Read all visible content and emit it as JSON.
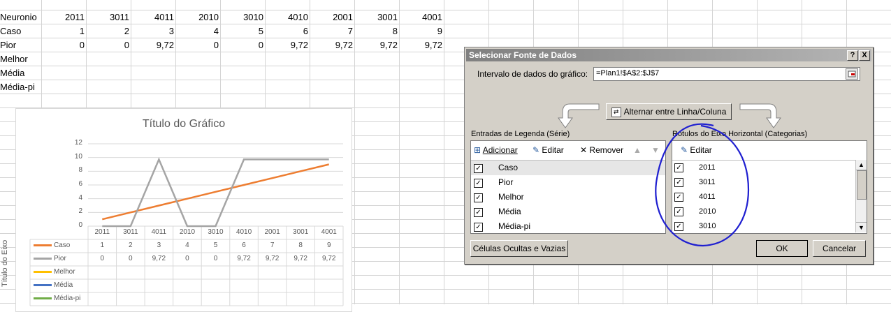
{
  "sheet": {
    "row_labels": [
      "Neuronio",
      "Caso",
      "Pior",
      "Melhor",
      "Média",
      "Média-pi"
    ],
    "headers": [
      "2011",
      "3011",
      "4011",
      "2010",
      "3010",
      "4010",
      "2001",
      "3001",
      "4001"
    ],
    "caso": [
      "1",
      "2",
      "3",
      "4",
      "5",
      "6",
      "7",
      "8",
      "9"
    ],
    "pior": [
      "0",
      "0",
      "9,72",
      "0",
      "0",
      "9,72",
      "9,72",
      "9,72",
      "9,72"
    ]
  },
  "chart": {
    "title": "Título do Gráfico",
    "ylabel": "Título do Eixo",
    "yticks": [
      "12",
      "10",
      "8",
      "6",
      "4",
      "2",
      "0"
    ],
    "legend": [
      "Caso",
      "Pior",
      "Melhor",
      "Média",
      "Média-pi"
    ],
    "colors": {
      "Caso": "#ed7d31",
      "Pior": "#a5a5a5",
      "Melhor": "#ffc000",
      "Média": "#4472c4",
      "Média-pi": "#70ad47"
    }
  },
  "chart_data": {
    "type": "line",
    "title": "Título do Gráfico",
    "xlabel": "",
    "ylabel": "Título do Eixo",
    "ylim": [
      0,
      12
    ],
    "categories": [
      "2011",
      "3011",
      "4011",
      "2010",
      "3010",
      "4010",
      "2001",
      "3001",
      "4001"
    ],
    "series": [
      {
        "name": "Caso",
        "values": [
          1,
          2,
          3,
          4,
          5,
          6,
          7,
          8,
          9
        ]
      },
      {
        "name": "Pior",
        "values": [
          0,
          0,
          9.72,
          0,
          0,
          9.72,
          9.72,
          9.72,
          9.72
        ]
      },
      {
        "name": "Melhor",
        "values": []
      },
      {
        "name": "Média",
        "values": []
      },
      {
        "name": "Média-pi",
        "values": []
      }
    ],
    "grid": true,
    "legend": "data-table"
  },
  "dialog": {
    "title": "Selecionar Fonte de Dados",
    "help_btn": "?",
    "close_btn": "X",
    "range_label": "Intervalo de dados do gráfico:",
    "range_value": "=Plan1!$A$2:$J$7",
    "switch_button": "Alternar entre Linha/Coluna",
    "legend_header": "Entradas de Legenda (Série)",
    "axis_header": "Rótulos do Eixo Horizontal (Categorias)",
    "add": "Adicionar",
    "edit": "Editar",
    "remove": "Remover",
    "edit_axis": "Editar",
    "series": [
      "Caso",
      "Pior",
      "Melhor",
      "Média",
      "Média-pi"
    ],
    "categories": [
      "2011",
      "3011",
      "4011",
      "2010",
      "3010"
    ],
    "hidden_cells_button": "Células Ocultas e Vazias",
    "ok": "OK",
    "cancel": "Cancelar"
  }
}
